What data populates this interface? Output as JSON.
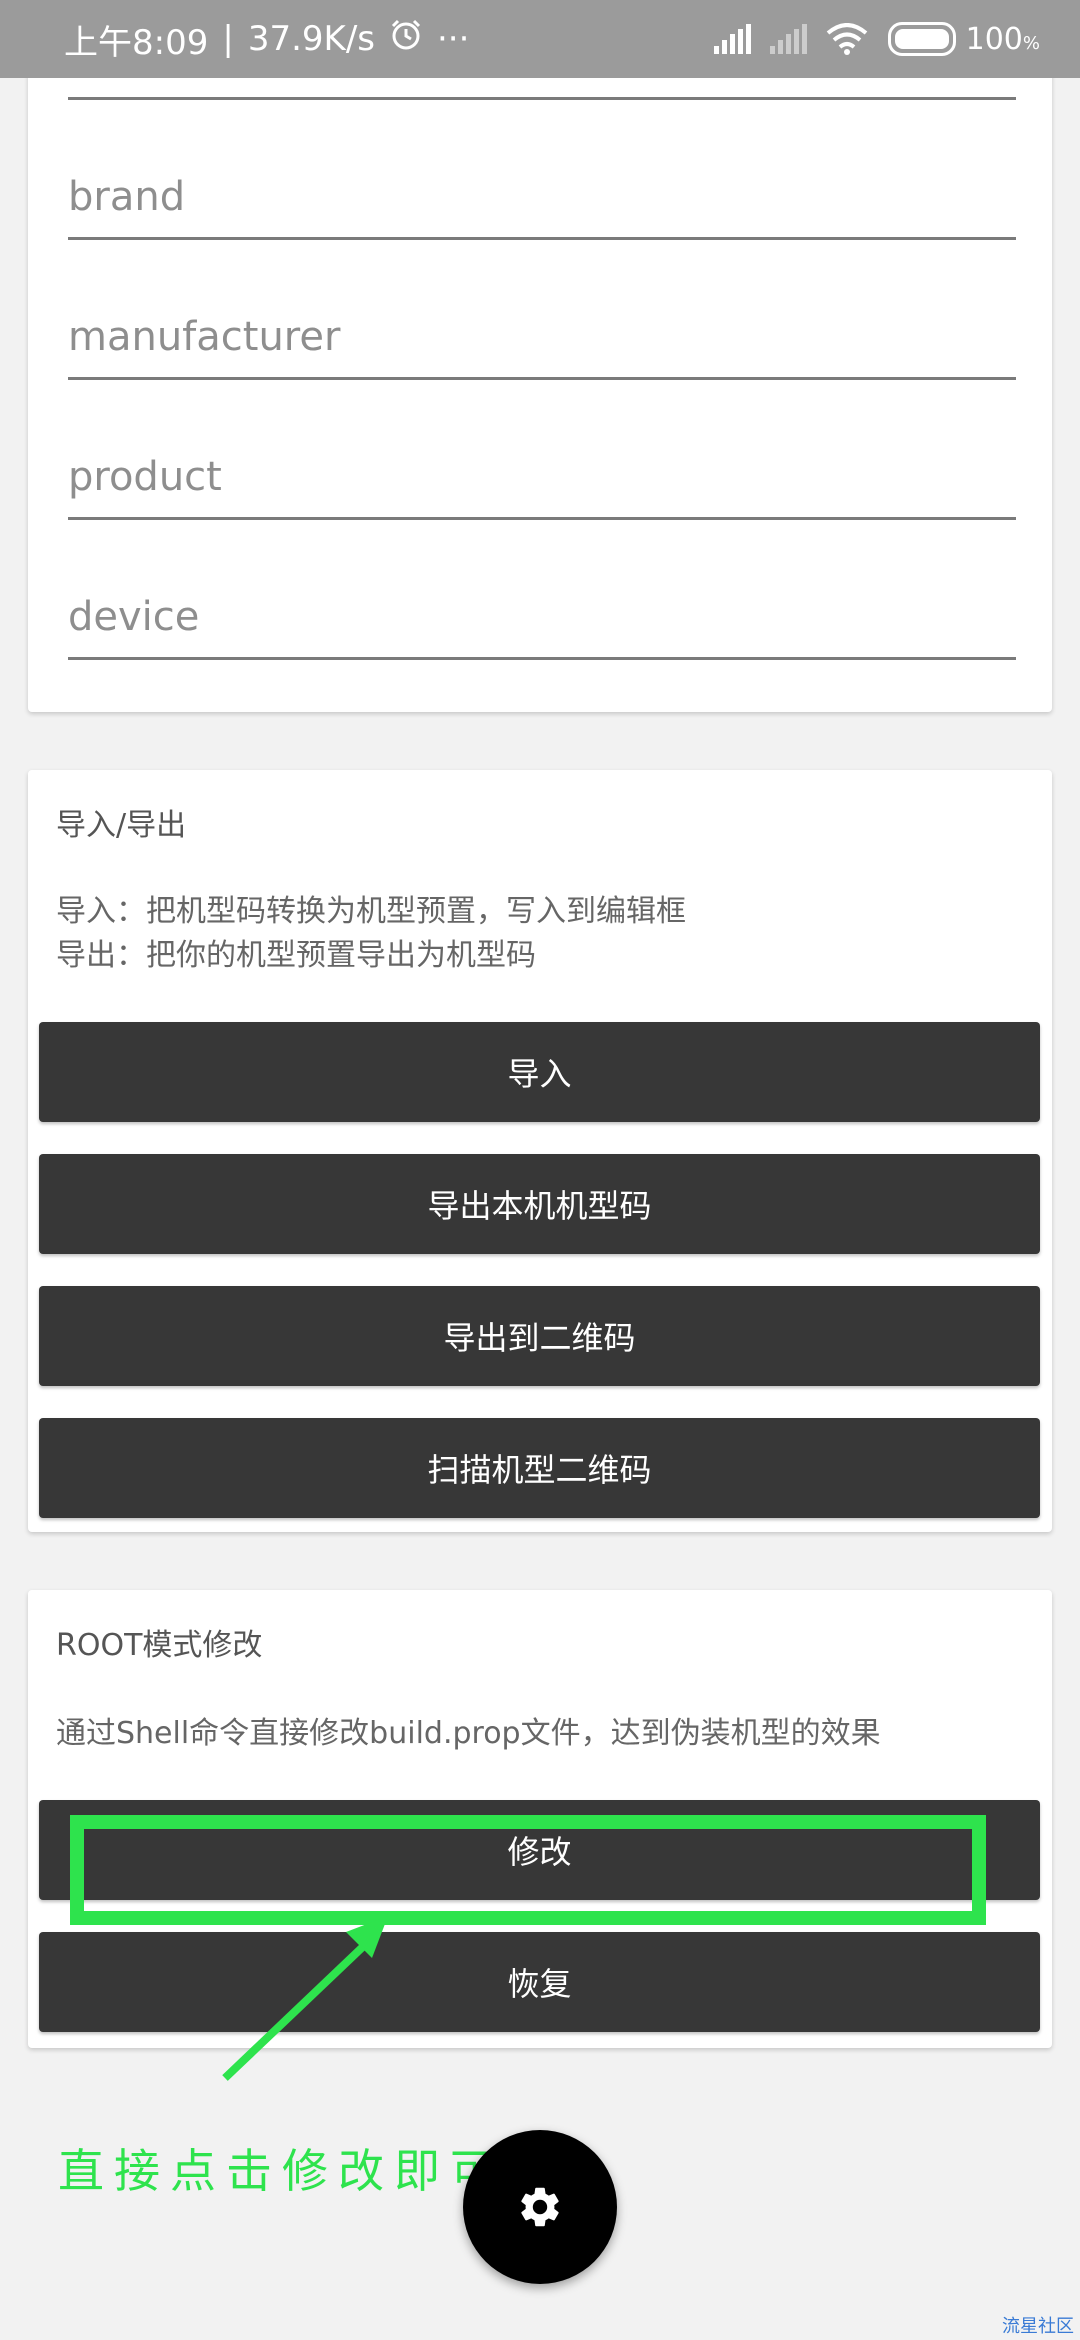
{
  "statusbar": {
    "time": "上午8:09",
    "separator": "|",
    "speed": "37.9K/s",
    "more": "···",
    "battery": "100",
    "battery_unit": "%"
  },
  "fields": {
    "brand": "brand",
    "manufacturer": "manufacturer",
    "product": "product",
    "device": "device"
  },
  "import_export": {
    "title": "导入/导出",
    "desc_import": "导入：把机型码转换为机型预置，写入到编辑框",
    "desc_export": "导出：把你的机型预置导出为机型码",
    "btn_import": "导入",
    "btn_export_local": "导出本机机型码",
    "btn_export_qr": "导出到二维码",
    "btn_scan_qr": "扫描机型二维码"
  },
  "root_mode": {
    "title": "ROOT模式修改",
    "desc": "通过Shell命令直接修改build.prop文件，达到伪装机型的效果",
    "btn_modify": "修改",
    "btn_restore": "恢复"
  },
  "annotation": {
    "text": "直接点击修改即可",
    "color": "#2ee34d"
  },
  "watermark": "流星社区",
  "icons": {
    "fab": "gear-icon",
    "alarm": "alarm-icon",
    "signal": "signal-icon",
    "wifi": "wifi-icon",
    "battery": "battery-icon"
  }
}
